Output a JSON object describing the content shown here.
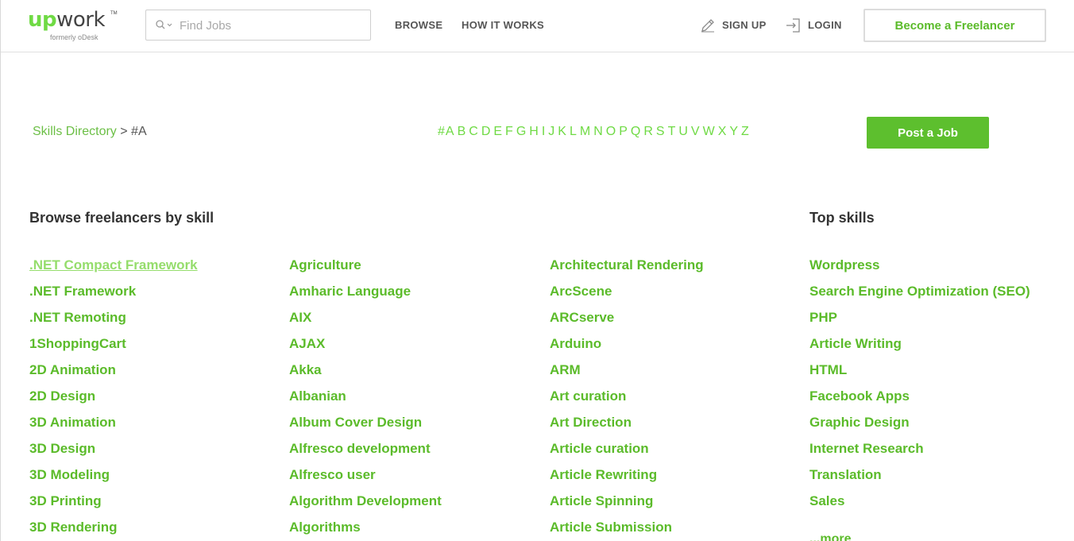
{
  "header": {
    "logo_text_up": "up",
    "logo_text_work": "work",
    "logo_tm": "TM",
    "logo_sub": "formerly oDesk",
    "search_placeholder": "Find Jobs",
    "browse": "BROWSE",
    "how_it_works": "HOW IT WORKS",
    "sign_up": "SIGN UP",
    "login": "LOGIN",
    "become_freelancer": "Become a Freelancer"
  },
  "subbar": {
    "breadcrumb_link": "Skills Directory",
    "breadcrumb_sep": ">",
    "breadcrumb_current": "#A",
    "letters": [
      "#A",
      "B",
      "C",
      "D",
      "E",
      "F",
      "G",
      "H",
      "I",
      "J",
      "K",
      "L",
      "M",
      "N",
      "O",
      "P",
      "Q",
      "R",
      "S",
      "T",
      "U",
      "V",
      "W",
      "X",
      "Y",
      "Z"
    ],
    "post_job": "Post a Job"
  },
  "browse": {
    "title": "Browse freelancers by skill",
    "columns": [
      [
        ".NET Compact Framework",
        ".NET Framework",
        ".NET Remoting",
        "1ShoppingCart",
        "2D Animation",
        "2D Design",
        "3D Animation",
        "3D Design",
        "3D Modeling",
        "3D Printing",
        "3D Rendering"
      ],
      [
        "Agriculture",
        "Amharic Language",
        "AIX",
        "AJAX",
        "Akka",
        "Albanian",
        "Album Cover Design",
        "Alfresco development",
        "Alfresco user",
        "Algorithm Development",
        "Algorithms"
      ],
      [
        "Architectural Rendering",
        "ArcScene",
        "ARCserve",
        "Arduino",
        "ARM",
        "Art curation",
        "Art Direction",
        "Article curation",
        "Article Rewriting",
        "Article Spinning",
        "Article Submission"
      ]
    ]
  },
  "top_skills": {
    "title": "Top skills",
    "items": [
      "Wordpress",
      "Search Engine Optimization (SEO)",
      "PHP",
      "Article Writing",
      "HTML",
      "Facebook Apps",
      "Graphic Design",
      "Internet Research",
      "Translation",
      "Sales"
    ],
    "more": "...more"
  },
  "colors": {
    "brand_green": "#6fda44",
    "link_green": "#5bbb2a",
    "button_green": "#5dbf2e"
  }
}
